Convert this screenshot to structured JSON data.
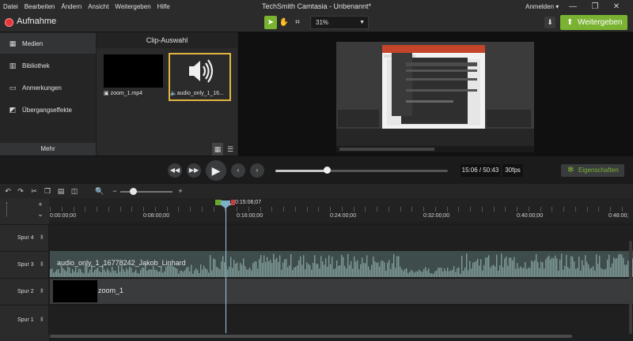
{
  "menu": [
    "Datei",
    "Bearbeiten",
    "Ändern",
    "Ansicht",
    "Weitergeben",
    "Hilfe"
  ],
  "app_title": "TechSmith Camtasia - Unbenannt*",
  "signin": "Anmelden ▾",
  "window_controls": [
    "—",
    "❐",
    "✕"
  ],
  "toolbar": {
    "record_label": "Aufnahme",
    "zoom_value": "31%",
    "share_label": "Weitergeben"
  },
  "sidebar": {
    "items": [
      {
        "label": "Medien",
        "icon": "film-icon"
      },
      {
        "label": "Bibliothek",
        "icon": "library-icon"
      },
      {
        "label": "Anmerkungen",
        "icon": "annotation-icon"
      },
      {
        "label": "Übergangseffekte",
        "icon": "transition-icon"
      }
    ],
    "more_label": "Mehr"
  },
  "bin": {
    "title": "Clip-Auswahl",
    "clips": [
      {
        "name": "zoom_1.mp4"
      },
      {
        "name": "audio_only_1_16..."
      }
    ]
  },
  "playback": {
    "timecode": "15:06 / 50:43",
    "fps": "30fps",
    "properties_label": "Eigenschaften",
    "progress": 0.3
  },
  "timeline": {
    "playhead_time": "0:15:06;07",
    "ruler": [
      "0:00:00;00",
      "0:08:00;00",
      "0:16:00;00",
      "0:24:00;00",
      "0:32:00;00",
      "0:40:00;00",
      "0:48:00;"
    ],
    "tracks": [
      {
        "label": "Spur 4"
      },
      {
        "label": "Spur 3",
        "clip": "audio_only_1_16778242_Jakob_Linhard"
      },
      {
        "label": "Spur 2",
        "clip": "zoom_1"
      },
      {
        "label": "Spur 1"
      }
    ]
  },
  "colors": {
    "accent": "#7ab332",
    "record": "#e8333a",
    "selection": "#e3b540",
    "audio_clip": "#3e4d4c"
  }
}
